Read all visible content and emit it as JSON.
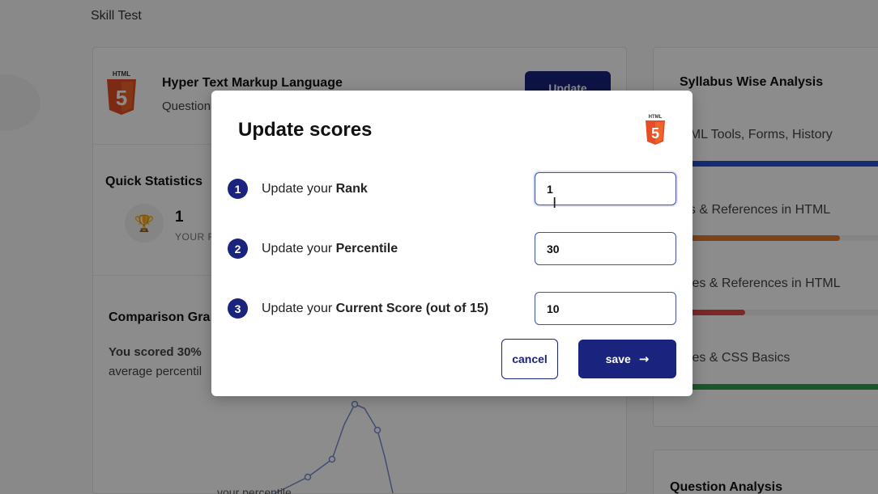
{
  "page": {
    "title": "Skill Test"
  },
  "course": {
    "name": "Hyper Text Markup Language",
    "subtitle": "Question",
    "update_label": "Update"
  },
  "quick_stats": {
    "title": "Quick Statistics",
    "rank_value": "1",
    "rank_label": "YOUR R"
  },
  "comparison": {
    "title": "Comparison Gra",
    "line1": "You scored 30%",
    "line2": "average percentil",
    "your_percentile_label": "your percentile"
  },
  "syllabus": {
    "title": "Syllabus Wise Analysis",
    "items": [
      {
        "label": "TML Tools, Forms, History",
        "fill": 1.0,
        "color": "#2a4fd6"
      },
      {
        "label": "gs & References in HTML",
        "fill": 0.75,
        "color": "#e07a2e"
      },
      {
        "label": "bles & References in HTML",
        "fill": 0.3,
        "color": "#e04a48"
      },
      {
        "label": "bles & CSS Basics",
        "fill": 1.0,
        "color": "#2e9e4f"
      }
    ]
  },
  "question_analysis": {
    "title": "Question Analysis"
  },
  "modal": {
    "title": "Update scores",
    "logo_text": "HTML",
    "steps": [
      {
        "number": "1",
        "prefix": "Update your ",
        "bold": "Rank",
        "value": "1"
      },
      {
        "number": "2",
        "prefix": "Update your ",
        "bold": "Percentile",
        "value": "30"
      },
      {
        "number": "3",
        "prefix": "Update your ",
        "bold": "Current Score (out of 15)",
        "value": "10"
      }
    ],
    "cancel_label": "cancel",
    "save_label": "save",
    "save_icon": "arrow-right-icon"
  },
  "colors": {
    "primary": "#1a237e",
    "input_border": "#3f51b5",
    "html_orange": "#e44d26"
  }
}
